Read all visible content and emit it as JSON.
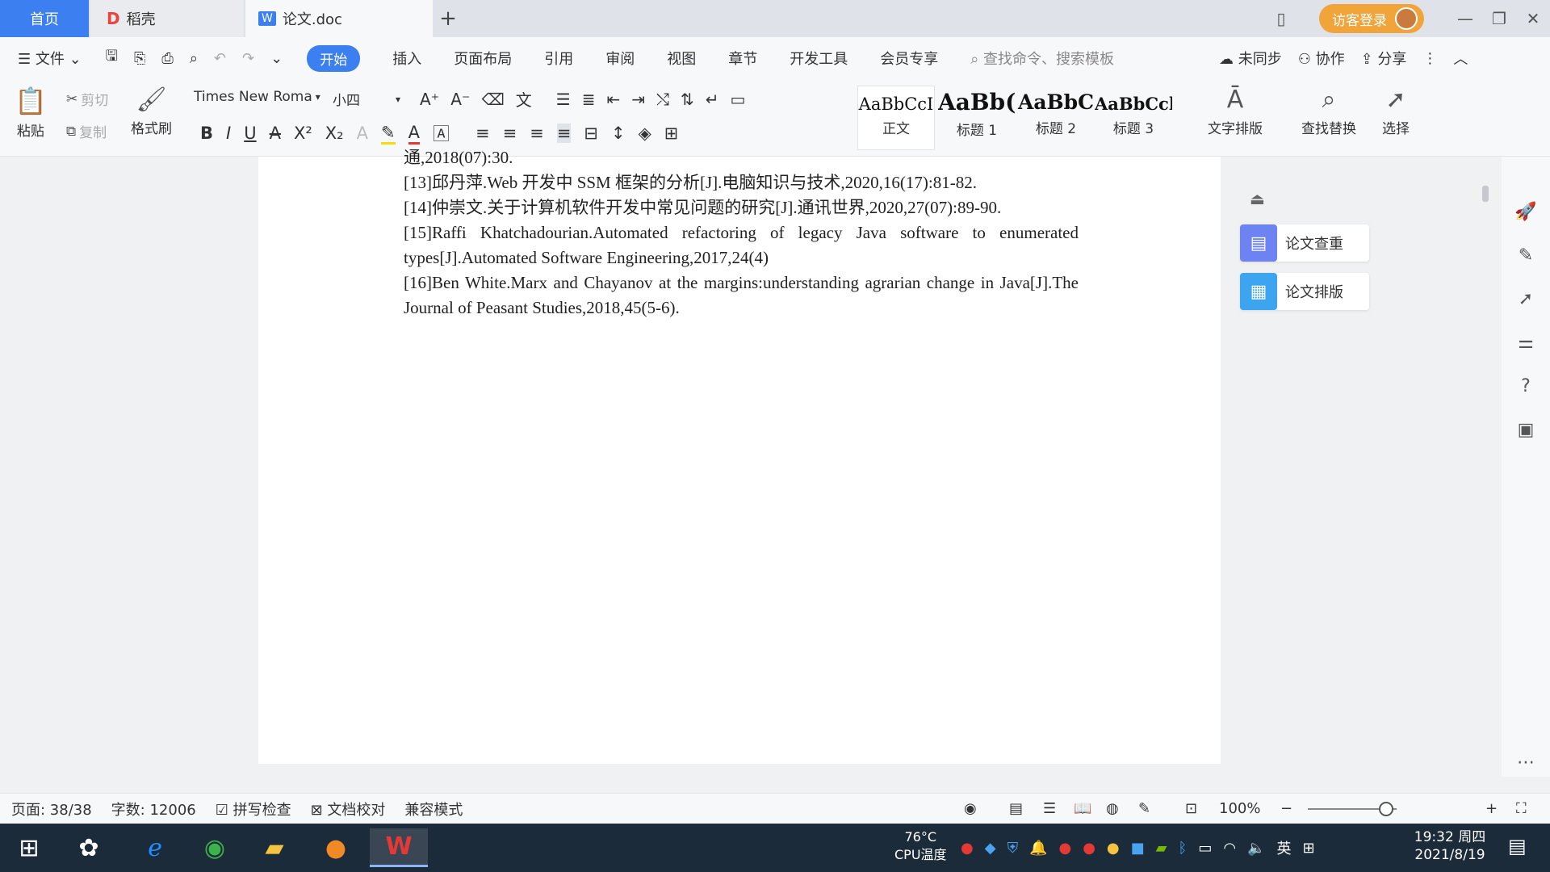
{
  "titlebar": {
    "tab_home": "首页",
    "tab_daoke": "稻壳",
    "tab_doc": "论文.doc",
    "login_label": "访客登录"
  },
  "menu": {
    "file": "文件",
    "items": [
      "开始",
      "插入",
      "页面布局",
      "引用",
      "审阅",
      "视图",
      "章节",
      "开发工具",
      "会员专享"
    ],
    "search_placeholder": "查找命令、搜索模板",
    "sync": "未同步",
    "collab": "协作",
    "share": "分享"
  },
  "ribbon": {
    "paste": "粘贴",
    "cut": "剪切",
    "copy": "复制",
    "format_painter": "格式刷",
    "font_name": "Times New Roma",
    "font_size": "小四",
    "styles": [
      {
        "sample": "AaBbCcI",
        "label": "正文"
      },
      {
        "sample": "AaBb(",
        "label": "标题 1"
      },
      {
        "sample": "AaBbC",
        "label": "标题 2"
      },
      {
        "sample": "AaBbCcl",
        "label": "标题 3"
      }
    ],
    "text_layout": "文字排版",
    "find_replace": "查找替换",
    "select": "选择"
  },
  "document": {
    "paragraphs": [
      "通,2018(07):30.",
      "[13]邱丹萍.Web 开发中 SSM 框架的分析[J].电脑知识与技术,2020,16(17):81-82.",
      "[14]仲崇文.关于计算机软件开发中常见问题的研究[J].通讯世界,2020,27(07):89-90.",
      "[15]Raffi Khatchadourian.Automated refactoring of legacy Java software to enumerated types[J].Automated Software Engineering,2017,24(4)",
      "[16]Ben White.Marx and Chayanov at the margins:understanding agrarian change in Java[J].The Journal of Peasant Studies,2018,45(5-6)."
    ]
  },
  "side_panel": {
    "check": "论文查重",
    "layout": "论文排版"
  },
  "status": {
    "page": "页面: 38/38",
    "words": "字数: 12006",
    "spell": "拼写检查",
    "proof": "文档校对",
    "compat": "兼容模式",
    "zoom": "100%"
  },
  "taskbar": {
    "cpu_temp": "76°C",
    "cpu_label": "CPU温度",
    "ime": "英",
    "time": "19:32 周四",
    "date": "2021/8/19"
  },
  "colors": {
    "accent": "#3c7ff0",
    "login": "#f0a43a",
    "taskbar": "#1c2b3a"
  }
}
